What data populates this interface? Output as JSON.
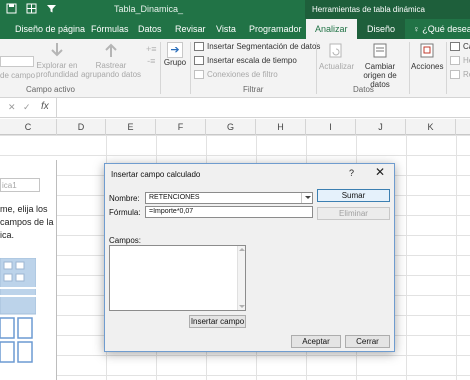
{
  "window": {
    "title": "Tabla_Dinamica_",
    "context_tools": "Herramientas de tabla dinámica"
  },
  "tabs": [
    {
      "label": "Diseño de página"
    },
    {
      "label": "Fórmulas"
    },
    {
      "label": "Datos"
    },
    {
      "label": "Revisar"
    },
    {
      "label": "Vista"
    },
    {
      "label": "Programador"
    },
    {
      "label": "Analizar"
    },
    {
      "label": "Diseño"
    },
    {
      "label": "¿Qué desea"
    }
  ],
  "ribbon": {
    "campo_activo_label": "Campo activo",
    "field_settings_label": "de campo",
    "explorar_label": "Explorar en profundidad",
    "rastrear_label": "Rastrear agrupando datos",
    "grupo_label": "Grupo",
    "insertar_seg": "Insertar Segmentación de datos",
    "insertar_escala": "Insertar escala de tiempo",
    "conexiones": "Conexiones de filtro",
    "filtrar_label": "Filtrar",
    "actualizar_label": "Actualizar",
    "cambiar_origen_label": "Cambiar origen de datos",
    "datos_label": "Datos",
    "acciones_label": "Acciones",
    "side_items": [
      "Ca",
      "He",
      "Re"
    ]
  },
  "formula_bar": {
    "cancel": "✕",
    "enter": "✓",
    "fx": "fx",
    "value": ""
  },
  "columns": [
    "C",
    "D",
    "E",
    "F",
    "G",
    "H",
    "I",
    "J",
    "K"
  ],
  "panel": {
    "name_box": "ica1",
    "text_lines": [
      "me, elija los",
      "campos de la",
      "ica."
    ]
  },
  "dialog": {
    "title": "Insertar campo calculado",
    "help": "?",
    "close": "✕",
    "nombre_label": "Nombre:",
    "nombre_value": "RETENCIONES",
    "formula_label": "Fórmula:",
    "formula_value": "=Importe*0,07",
    "sumar_label": "Sumar",
    "eliminar_label": "Eliminar",
    "campos_label": "Campos:",
    "insertar_campo_label": "Insertar campo",
    "aceptar_label": "Aceptar",
    "cerrar_label": "Cerrar"
  }
}
